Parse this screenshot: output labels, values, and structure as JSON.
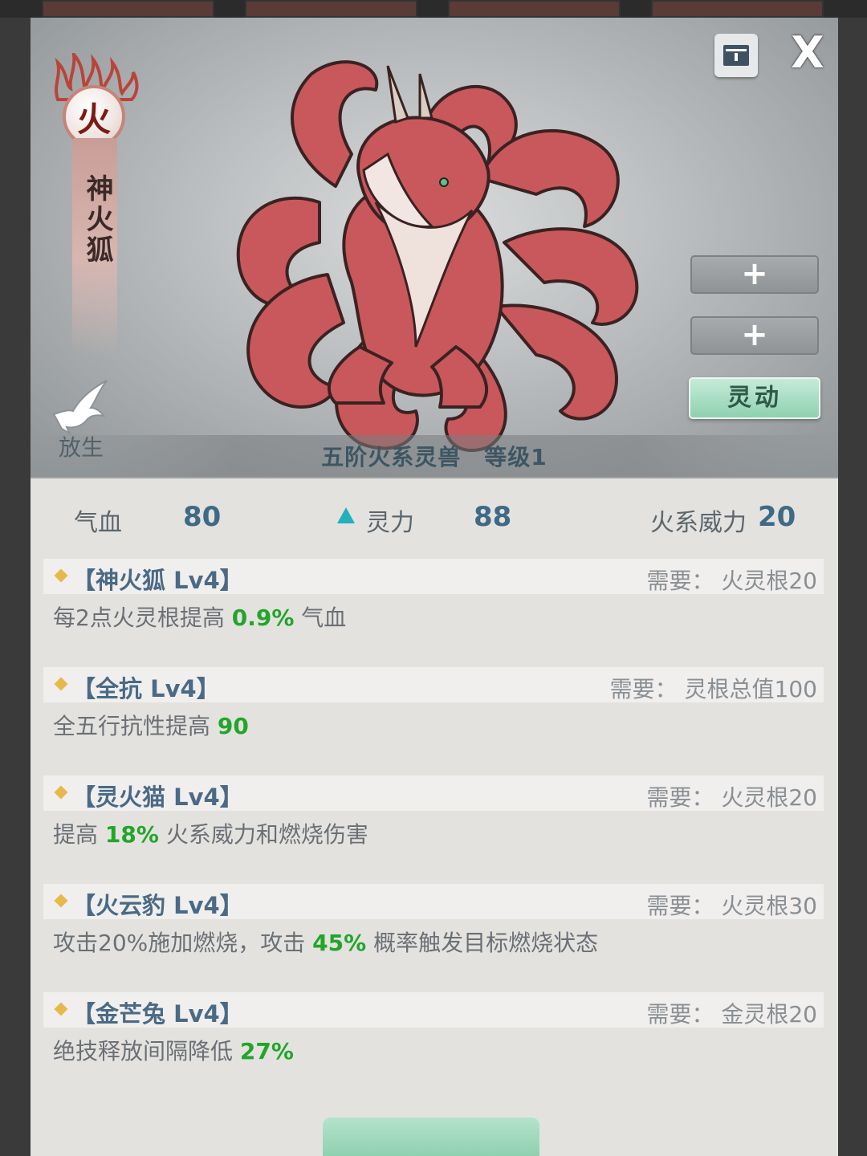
{
  "header": {
    "element": "火",
    "beast_name": "神火狐",
    "release_label": "放生",
    "grade_text": "五阶火系灵兽　等级1",
    "slot_buttons": [
      "+",
      "+"
    ],
    "lingdong_label": "灵动",
    "close_label": "X"
  },
  "stats": {
    "hp_label": "气血",
    "hp_value": "80",
    "spirit_label": "灵力",
    "spirit_value": "88",
    "fire_label": "火系威力",
    "fire_value": "20"
  },
  "skills": [
    {
      "title": "【神火狐 Lv4】",
      "req": "需要：  火灵根20",
      "desc_pre": "每2点火灵根提高 ",
      "desc_hl": "0.9%",
      "desc_post": " 气血"
    },
    {
      "title": "【全抗 Lv4】",
      "req": "需要：  灵根总值100",
      "desc_pre": "全五行抗性提高 ",
      "desc_hl": "90",
      "desc_post": ""
    },
    {
      "title": "【灵火猫 Lv4】",
      "req": "需要：  火灵根20",
      "desc_pre": "提高 ",
      "desc_hl": "18%",
      "desc_post": " 火系威力和燃烧伤害"
    },
    {
      "title": "【火云豹 Lv4】",
      "req": "需要：  火灵根30",
      "desc_pre": "攻击20%施加燃烧，攻击 ",
      "desc_hl": "45%",
      "desc_post": " 概率触发目标燃烧状态"
    },
    {
      "title": "【金芒兔 Lv4】",
      "req": "需要：  金灵根20",
      "desc_pre": "绝技释放间隔降低 ",
      "desc_hl": "27%",
      "desc_post": ""
    }
  ],
  "colors": {
    "highlight": "#22a52a",
    "accent": "#3f6a86",
    "fox": "#c9585c"
  }
}
